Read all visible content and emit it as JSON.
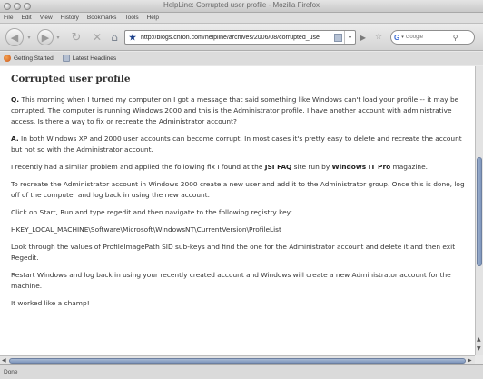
{
  "window": {
    "title": "HelpLine: Corrupted user profile - Mozilla Firefox"
  },
  "menu": [
    "File",
    "Edit",
    "View",
    "History",
    "Bookmarks",
    "Tools",
    "Help"
  ],
  "nav": {
    "url": "http://blogs.chron.com/helpline/archives/2006/08/corrupted_use",
    "search_placeholder": "Google"
  },
  "bookmarks": [
    "Getting Started",
    "Latest Headlines"
  ],
  "article": {
    "title": "Corrupted user profile",
    "q_label": "Q.",
    "question": "This morning when I turned my computer on I got a message that said something like Windows can't load your profile -- it may be corrupted. The computer is running Windows 2000 and this is the Administrator profile. I have another account with administrative access. Is there a way to fix or recreate the Administrator account?",
    "a_label": "A.",
    "answer": "In both Windows XP and 2000 user accounts can become corrupt. In most cases it's pretty easy to delete and recreate the account but not so with the Administrator account.",
    "p3_before": "I recently had a similar problem and applied the following fix I found at the ",
    "p3_link1": "JSI FAQ",
    "p3_middle": " site run by ",
    "p3_link2": "Windows IT Pro",
    "p3_after": " magazine.",
    "p4": "To recreate the Administrator account in Windows 2000 create a new user and add it to the Administrator group. Once this is done, log off of the computer and log back in using the new account.",
    "p5": "Click on Start, Run and type regedit and then navigate to the following registry key:",
    "p6": "HKEY_LOCAL_MACHINE\\Software\\Microsoft\\WindowsNT\\CurrentVersion\\ProfileList",
    "p7": "Look through the values of ProfileImagePath SID sub-keys and find the one for the Administrator account and delete it and then exit Regedit.",
    "p8": "Restart Windows and log back in using your recently created account and Windows will create a new Administrator account for the machine.",
    "p9": "It worked like a champ!"
  },
  "status": {
    "text": "Done"
  }
}
